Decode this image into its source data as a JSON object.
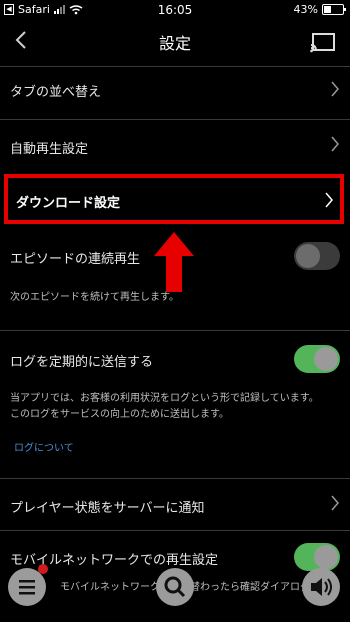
{
  "status": {
    "back_app": "Safari",
    "time": "16:05",
    "battery": "43%"
  },
  "nav": {
    "title": "設定"
  },
  "rows": {
    "tab_sort": "タブの並べ替え",
    "autoplay": "自動再生設定",
    "download": "ダウンロード設定",
    "episode_continuous": "エピソードの連続再生",
    "episode_continuous_desc": "次のエピソードを続けて再生します。",
    "send_log": "ログを定期的に送信する",
    "send_log_desc_1": "当アプリでは、お客様の利用状況をログという形で記録しています。",
    "send_log_desc_2": "このログをサービスの向上のために送出します。",
    "about_log": "ログについて",
    "player_state": "プレイヤー状態をサーバーに通知",
    "mobile_network": "モバイルネットワークでの再生設定",
    "mobile_network_desc_partial": "モバイルネットワークに切り替わったら確認ダイアログ"
  },
  "toggles": {
    "episode_continuous": "off",
    "send_log": "on",
    "mobile_network": "on"
  },
  "colors": {
    "highlight": "#e60000",
    "toggle_on": "#54b45a",
    "link": "#4a8ed6"
  }
}
